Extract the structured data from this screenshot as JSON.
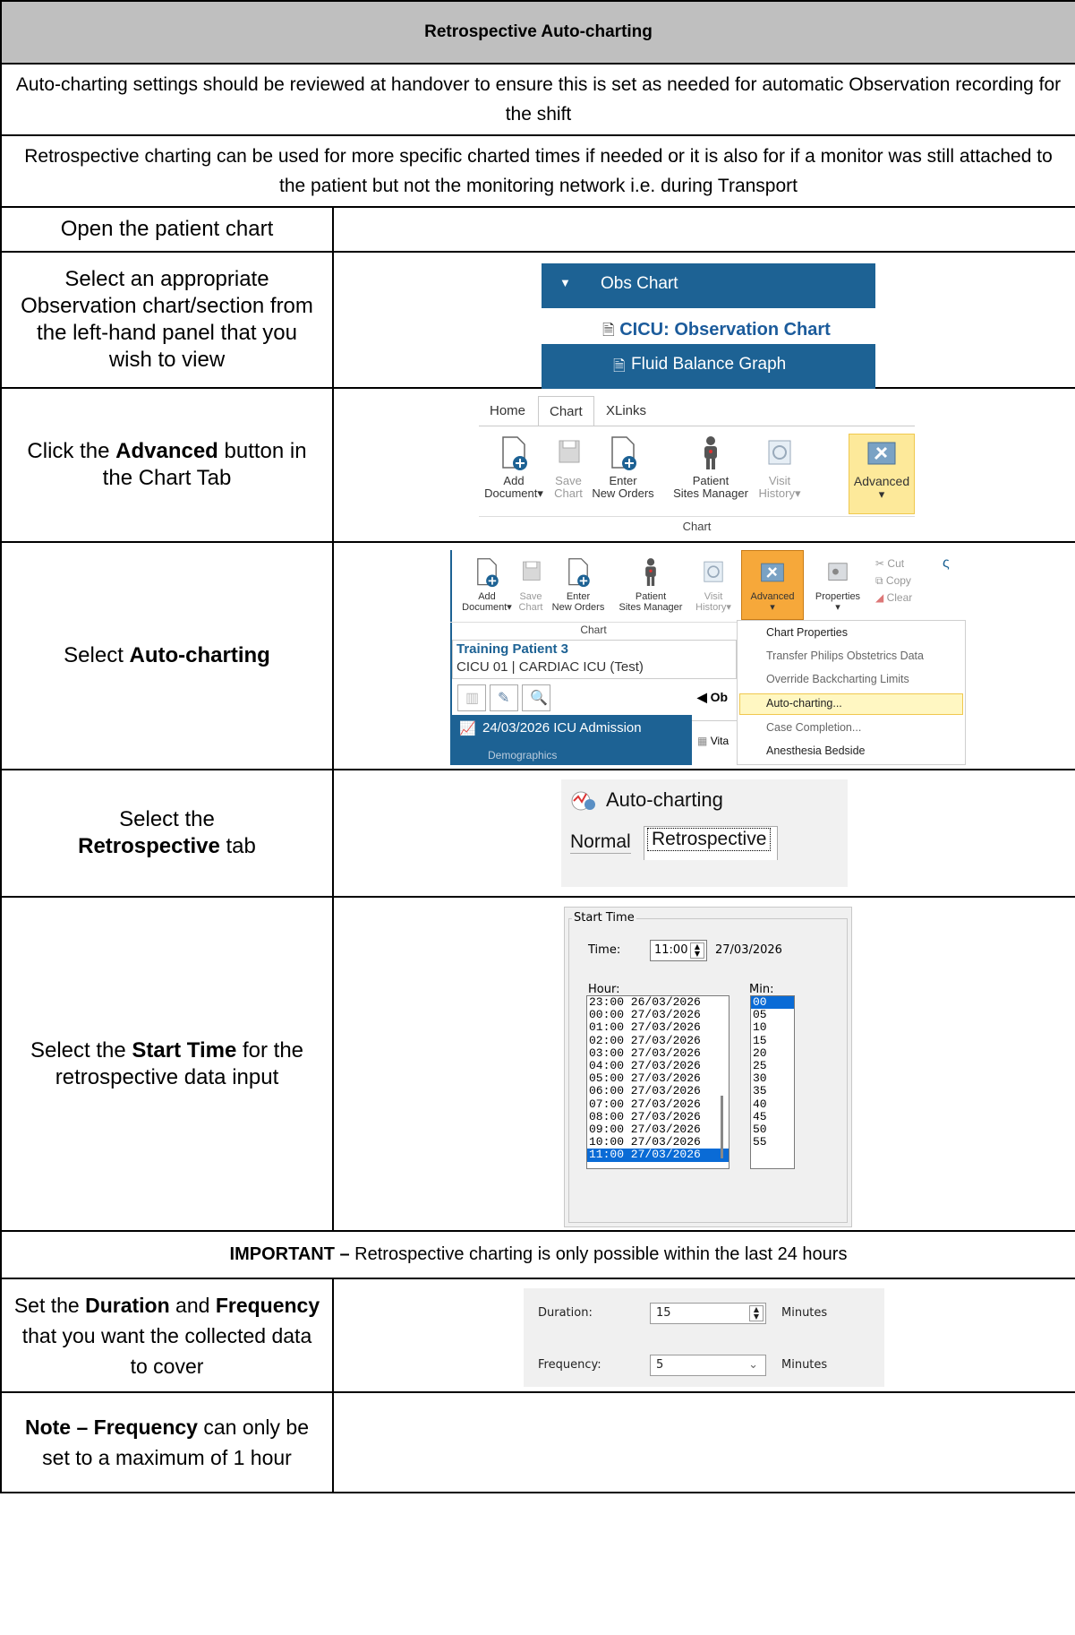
{
  "header": {
    "title": "Retrospective Auto-charting"
  },
  "intro": {
    "review": "Auto-charting settings should be reviewed at handover to ensure this is set as needed for automatic Observation recording for the shift",
    "retro": "Retrospective charting can be used for more specific charted times if needed or it is also for if a monitor was still attached to the patient but not the monitoring network i.e. during Transport"
  },
  "steps": {
    "open": "Open the patient chart",
    "select_obs": "Select an appropriate Observation chart/section from the left-hand panel that you wish to view",
    "click_pre": "Click the ",
    "click_bold": "Advanced",
    "click_post": " button in the Chart Tab",
    "autochart_pre": "Select ",
    "autochart_bold": "Auto-charting",
    "retro_pre": "Select the",
    "retro_bold": "Retrospective",
    "retro_post": " tab",
    "start_pre": "Select the ",
    "start_bold": "Start Time",
    "start_post": " for the retrospective data input",
    "important_bold": "IMPORTANT – ",
    "important_text": "Retrospective charting is only possible within the last 24 hours",
    "dur_pre": "Set the ",
    "dur_bold1": "Duration",
    "dur_mid": " and ",
    "dur_bold2": "Frequency",
    "dur_post": " that you want the collected data to cover",
    "note_bold1": "Note – ",
    "note_bold2": "Frequency",
    "note_post": " can only be set to a maximum of 1 hour"
  },
  "obs_panel": {
    "section": "Obs Chart",
    "link": "CICU: Observation Chart",
    "graph": "Fluid Balance Graph"
  },
  "ribbon": {
    "tabs": [
      "Home",
      "Chart",
      "XLinks"
    ],
    "buttons": [
      {
        "l1": "Add",
        "l2": "Document▾"
      },
      {
        "l1": "Save",
        "l2": "Chart"
      },
      {
        "l1": "Enter",
        "l2": "New Orders"
      },
      {
        "l1": "Patient",
        "l2": "Sites Manager"
      },
      {
        "l1": "Visit",
        "l2": "History▾"
      },
      {
        "l1": "Advanced",
        "l2": "▾"
      }
    ],
    "group": "Chart"
  },
  "ribbon2": {
    "properties": "Properties",
    "cut": "Cut",
    "copy": "Copy",
    "clear": "Clear",
    "group": "Chart",
    "patient_name": "Training Patient 3",
    "patient_loc": "CICU 01 | CARDIAC ICU (Test)",
    "encounter": "24/03/2026 ICU Admission",
    "ob": "Ob",
    "vita": "Vita",
    "cut_off": "Demographics",
    "menu": [
      "Chart Properties",
      "Transfer Philips Obstetrics Data",
      "Override Backcharting Limits",
      "Auto-charting...",
      "Case Completion...",
      "Anesthesia Bedside"
    ]
  },
  "autocharting": {
    "title": "Auto-charting",
    "tab_normal": "Normal",
    "tab_retro": "Retrospective"
  },
  "start_time": {
    "group": "Start Time",
    "time_label": "Time:",
    "time_value": "11:00",
    "date_value": "27/03/2026",
    "hour_label": "Hour:",
    "min_label": "Min:",
    "hours": [
      "23:00 26/03/2026",
      "00:00 27/03/2026",
      "01:00 27/03/2026",
      "02:00 27/03/2026",
      "03:00 27/03/2026",
      "04:00 27/03/2026",
      "05:00 27/03/2026",
      "06:00 27/03/2026",
      "07:00 27/03/2026",
      "08:00 27/03/2026",
      "09:00 27/03/2026",
      "10:00 27/03/2026",
      "11:00 27/03/2026"
    ],
    "mins": [
      "00",
      "05",
      "10",
      "15",
      "20",
      "25",
      "30",
      "35",
      "40",
      "45",
      "50",
      "55"
    ]
  },
  "duration": {
    "duration_label": "Duration:",
    "duration_value": "15",
    "frequency_label": "Frequency:",
    "frequency_value": "5",
    "unit": "Minutes"
  },
  "colors": {
    "header_bg": "#bfbfbf",
    "panel_blue": "#1d6294",
    "select_blue": "#0a6bd6",
    "advanced_yellow": "#fde99a"
  }
}
